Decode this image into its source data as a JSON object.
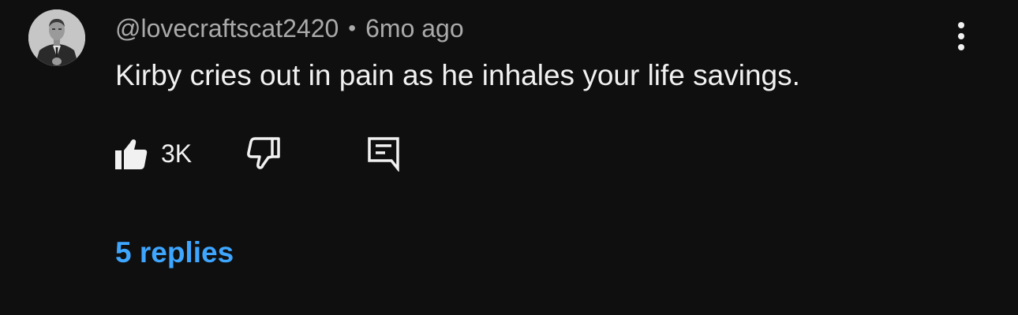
{
  "comment": {
    "author": "@lovecraftscat2420",
    "separator": "•",
    "time_ago": "6mo ago",
    "text": "Kirby cries out in pain as he inhales your life savings.",
    "like_count": "3K",
    "replies_label": "5 replies"
  },
  "icons": {
    "avatar": "avatar-photo",
    "more": "more-vertical-icon",
    "like": "thumbs-up-icon",
    "dislike": "thumbs-down-icon",
    "reply": "reply-comment-icon"
  },
  "colors": {
    "background": "#0f0f0f",
    "text_primary": "#f1f1f1",
    "text_secondary": "#aaaaaa",
    "link_blue": "#3ea6ff"
  }
}
